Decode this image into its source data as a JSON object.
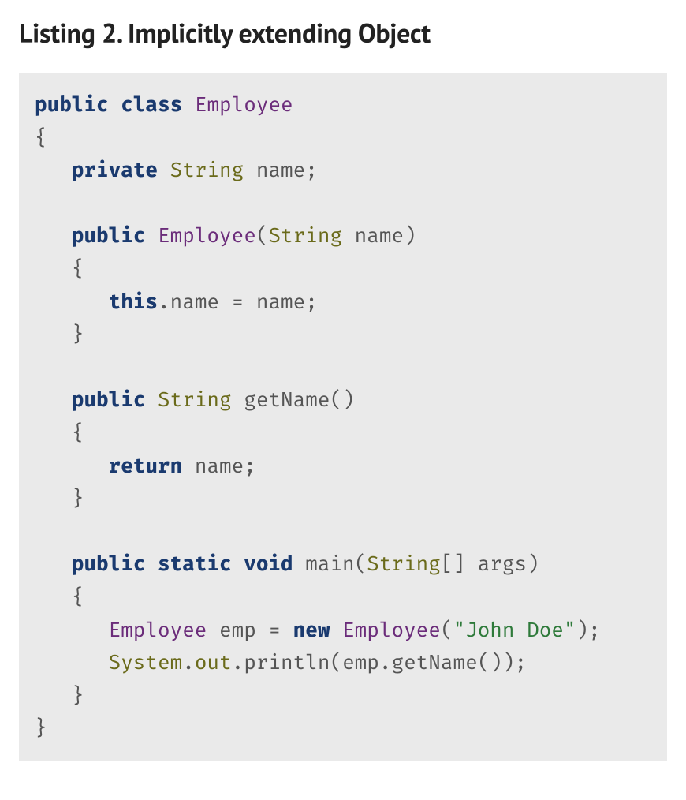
{
  "title": "Listing 2. Implicitly extending Object",
  "code": {
    "tokens": [
      {
        "t": "public",
        "c": "kw"
      },
      {
        "t": " "
      },
      {
        "t": "class",
        "c": "kw"
      },
      {
        "t": " "
      },
      {
        "t": "Employee",
        "c": "cls"
      },
      {
        "t": "\n"
      },
      {
        "t": "{",
        "c": "op"
      },
      {
        "t": "\n"
      },
      {
        "t": "   "
      },
      {
        "t": "private",
        "c": "kw"
      },
      {
        "t": " "
      },
      {
        "t": "String",
        "c": "type"
      },
      {
        "t": " name"
      },
      {
        "t": ";",
        "c": "op"
      },
      {
        "t": "\n"
      },
      {
        "t": "\n"
      },
      {
        "t": "   "
      },
      {
        "t": "public",
        "c": "kw"
      },
      {
        "t": " "
      },
      {
        "t": "Employee",
        "c": "cls"
      },
      {
        "t": "(",
        "c": "op"
      },
      {
        "t": "String",
        "c": "type"
      },
      {
        "t": " name"
      },
      {
        "t": ")",
        "c": "op"
      },
      {
        "t": "\n"
      },
      {
        "t": "   "
      },
      {
        "t": "{",
        "c": "op"
      },
      {
        "t": "\n"
      },
      {
        "t": "      "
      },
      {
        "t": "this",
        "c": "kw"
      },
      {
        "t": ".",
        "c": "op"
      },
      {
        "t": "name "
      },
      {
        "t": "=",
        "c": "op"
      },
      {
        "t": " name"
      },
      {
        "t": ";",
        "c": "op"
      },
      {
        "t": "\n"
      },
      {
        "t": "   "
      },
      {
        "t": "}",
        "c": "op"
      },
      {
        "t": "\n"
      },
      {
        "t": "\n"
      },
      {
        "t": "   "
      },
      {
        "t": "public",
        "c": "kw"
      },
      {
        "t": " "
      },
      {
        "t": "String",
        "c": "type"
      },
      {
        "t": " getName"
      },
      {
        "t": "()",
        "c": "op"
      },
      {
        "t": "\n"
      },
      {
        "t": "   "
      },
      {
        "t": "{",
        "c": "op"
      },
      {
        "t": "\n"
      },
      {
        "t": "      "
      },
      {
        "t": "return",
        "c": "kw"
      },
      {
        "t": " name"
      },
      {
        "t": ";",
        "c": "op"
      },
      {
        "t": "\n"
      },
      {
        "t": "   "
      },
      {
        "t": "}",
        "c": "op"
      },
      {
        "t": "\n"
      },
      {
        "t": "\n"
      },
      {
        "t": "   "
      },
      {
        "t": "public",
        "c": "kw"
      },
      {
        "t": " "
      },
      {
        "t": "static",
        "c": "kw"
      },
      {
        "t": " "
      },
      {
        "t": "void",
        "c": "kw"
      },
      {
        "t": " main"
      },
      {
        "t": "(",
        "c": "op"
      },
      {
        "t": "String",
        "c": "type"
      },
      {
        "t": "[]",
        "c": "op"
      },
      {
        "t": " args"
      },
      {
        "t": ")",
        "c": "op"
      },
      {
        "t": "\n"
      },
      {
        "t": "   "
      },
      {
        "t": "{",
        "c": "op"
      },
      {
        "t": "\n"
      },
      {
        "t": "      "
      },
      {
        "t": "Employee",
        "c": "cls"
      },
      {
        "t": " emp "
      },
      {
        "t": "=",
        "c": "op"
      },
      {
        "t": " "
      },
      {
        "t": "new",
        "c": "kw"
      },
      {
        "t": " "
      },
      {
        "t": "Employee",
        "c": "cls"
      },
      {
        "t": "(",
        "c": "op"
      },
      {
        "t": "\"John Doe\"",
        "c": "str"
      },
      {
        "t": ");",
        "c": "op"
      },
      {
        "t": "\n"
      },
      {
        "t": "      "
      },
      {
        "t": "System",
        "c": "type"
      },
      {
        "t": ".",
        "c": "op"
      },
      {
        "t": "out",
        "c": "type"
      },
      {
        "t": ".",
        "c": "op"
      },
      {
        "t": "println"
      },
      {
        "t": "(",
        "c": "op"
      },
      {
        "t": "emp"
      },
      {
        "t": ".",
        "c": "op"
      },
      {
        "t": "getName"
      },
      {
        "t": "());",
        "c": "op"
      },
      {
        "t": "\n"
      },
      {
        "t": "   "
      },
      {
        "t": "}",
        "c": "op"
      },
      {
        "t": "\n"
      },
      {
        "t": "}",
        "c": "op"
      }
    ]
  }
}
